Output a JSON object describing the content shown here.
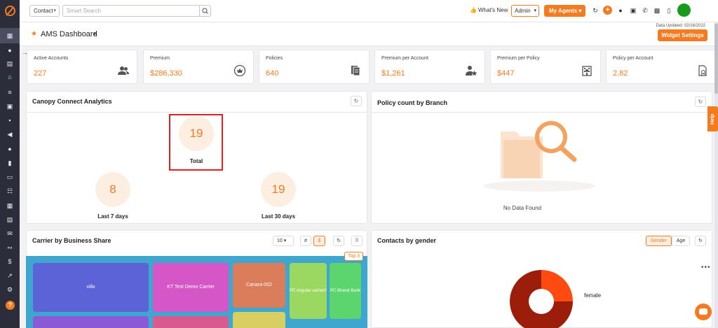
{
  "sidebar": {
    "icons": [
      "logo-icon",
      "home-icon",
      "contacts-icon",
      "documents-icon",
      "institution-icon",
      "list-icon",
      "report-icon",
      "briefcase-icon",
      "megaphone-icon",
      "user-icon",
      "chart-icon",
      "folder-icon",
      "team-icon",
      "calendar-icon",
      "schedule-icon",
      "mail-icon",
      "handshake-icon",
      "dollar-icon",
      "analytics-icon",
      "settings-icon",
      "help-icon"
    ]
  },
  "topbar": {
    "contact_select": "Contact",
    "search_placeholder": "Smart Search",
    "whats_new": "What's New",
    "admin_label": "Admin",
    "my_agents_label": "My Agents"
  },
  "header": {
    "title": "AMS Dashboard",
    "data_updated": "Data Updated: 02/16/2022",
    "widget_settings": "Widget Settings"
  },
  "kpis": [
    {
      "label": "Active Accounts",
      "value": "227",
      "icon": "users-icon"
    },
    {
      "label": "Premium",
      "value": "$286,330",
      "icon": "premium-badge-icon"
    },
    {
      "label": "Policies",
      "value": "640",
      "icon": "policies-icon"
    },
    {
      "label": "Premium per Account",
      "value": "$1,261",
      "icon": "user-star-icon"
    },
    {
      "label": "Premium per Policy",
      "value": "$447",
      "icon": "building-icon"
    },
    {
      "label": "Policy per Account",
      "value": "2.82",
      "icon": "policy-account-icon"
    }
  ],
  "canopy": {
    "title": "Canopy Connect Analytics",
    "total_value": "19",
    "total_label": "Total",
    "last7_value": "8",
    "last7_label": "Last 7 days",
    "last30_value": "19",
    "last30_label": "Last 30 days"
  },
  "branch": {
    "title": "Policy count by Branch",
    "no_data": "No Data Found"
  },
  "carrier": {
    "title": "Carrier by Business Share",
    "page_size": "10",
    "hash_label": "#",
    "dollar_label": "$",
    "top_label": "Top 3",
    "tiles": [
      {
        "label": "viilo",
        "color": "#5b63d6"
      },
      {
        "label": "KT Test Demo Carrier",
        "color": "#d557c7"
      },
      {
        "label": "Canara-002",
        "color": "#d97d5a"
      },
      {
        "label": "PC Angular carrier07",
        "color": "#9ad85f"
      },
      {
        "label": "PC Bharat Bank",
        "color": "#5dd56e"
      }
    ]
  },
  "gender": {
    "title": "Contacts by gender",
    "tab_gender": "Gender",
    "tab_age": "Age",
    "legend_female": "female",
    "colors": {
      "primary": "#9c1e0a",
      "secondary": "#ff4a10"
    }
  },
  "help_tab": "Help",
  "colors": {
    "accent": "#f47b20",
    "sidebar": "#2b2d3a"
  }
}
